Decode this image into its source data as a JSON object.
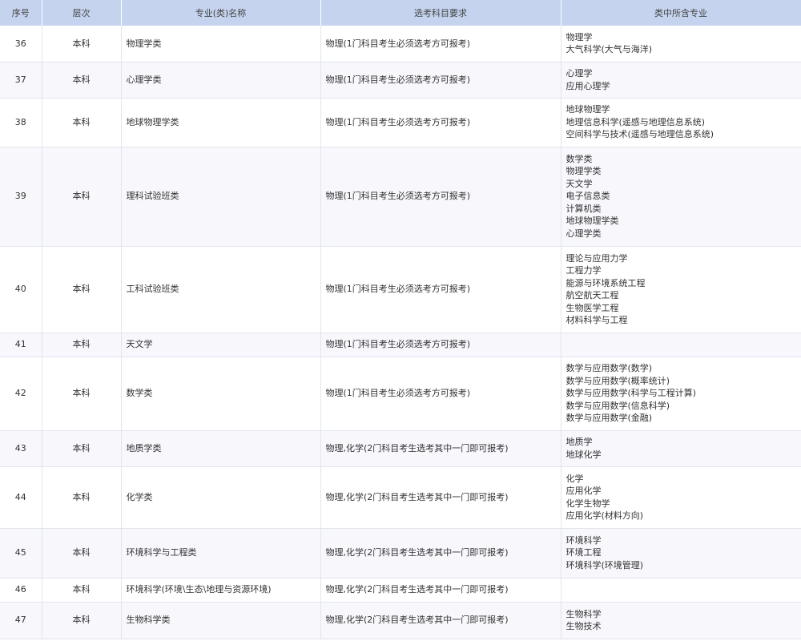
{
  "table": {
    "headers": [
      "序号",
      "层次",
      "专业(类)名称",
      "选考科目要求",
      "类中所含专业"
    ],
    "rows": [
      {
        "no": "36",
        "level": "本科",
        "name": "物理学类",
        "req": "物理(1门科目考生必须选考方可报考)",
        "subs": [
          "物理学",
          "大气科学(大气与海洋)"
        ]
      },
      {
        "no": "37",
        "level": "本科",
        "name": "心理学类",
        "req": "物理(1门科目考生必须选考方可报考)",
        "subs": [
          "心理学",
          "应用心理学"
        ]
      },
      {
        "no": "38",
        "level": "本科",
        "name": "地球物理学类",
        "req": "物理(1门科目考生必须选考方可报考)",
        "subs": [
          "地球物理学",
          "地理信息科学(遥感与地理信息系统)",
          "空间科学与技术(遥感与地理信息系统)"
        ]
      },
      {
        "no": "39",
        "level": "本科",
        "name": "理科试验班类",
        "req": "物理(1门科目考生必须选考方可报考)",
        "subs": [
          "数学类",
          "物理学类",
          "天文学",
          "电子信息类",
          "计算机类",
          "地球物理学类",
          "心理学类"
        ]
      },
      {
        "no": "40",
        "level": "本科",
        "name": "工科试验班类",
        "req": "物理(1门科目考生必须选考方可报考)",
        "subs": [
          "理论与应用力学",
          "工程力学",
          "能源与环境系统工程",
          "航空航天工程",
          "生物医学工程",
          "材料科学与工程"
        ]
      },
      {
        "no": "41",
        "level": "本科",
        "name": "天文学",
        "req": "物理(1门科目考生必须选考方可报考)",
        "subs": []
      },
      {
        "no": "42",
        "level": "本科",
        "name": "数学类",
        "req": "物理(1门科目考生必须选考方可报考)",
        "subs": [
          "数学与应用数学(数学)",
          "数学与应用数学(概率统计)",
          "数学与应用数学(科学与工程计算)",
          "数学与应用数学(信息科学)",
          "数学与应用数学(金融)"
        ]
      },
      {
        "no": "43",
        "level": "本科",
        "name": "地质学类",
        "req": "物理,化学(2门科目考生选考其中一门即可报考)",
        "subs": [
          "地质学",
          "地球化学"
        ]
      },
      {
        "no": "44",
        "level": "本科",
        "name": "化学类",
        "req": "物理,化学(2门科目考生选考其中一门即可报考)",
        "subs": [
          "化学",
          "应用化学",
          "化学生物学",
          "应用化学(材料方向)"
        ]
      },
      {
        "no": "45",
        "level": "本科",
        "name": "环境科学与工程类",
        "req": "物理,化学(2门科目考生选考其中一门即可报考)",
        "subs": [
          "环境科学",
          "环境工程",
          "环境科学(环境管理)"
        ]
      },
      {
        "no": "46",
        "level": "本科",
        "name": "环境科学(环境\\生态\\地理与资源环境)",
        "req": "物理,化学(2门科目考生选考其中一门即可报考)",
        "subs": []
      },
      {
        "no": "47",
        "level": "本科",
        "name": "生物科学类",
        "req": "物理,化学(2门科目考生选考其中一门即可报考)",
        "subs": [
          "生物科学",
          "生物技术"
        ]
      }
    ]
  }
}
